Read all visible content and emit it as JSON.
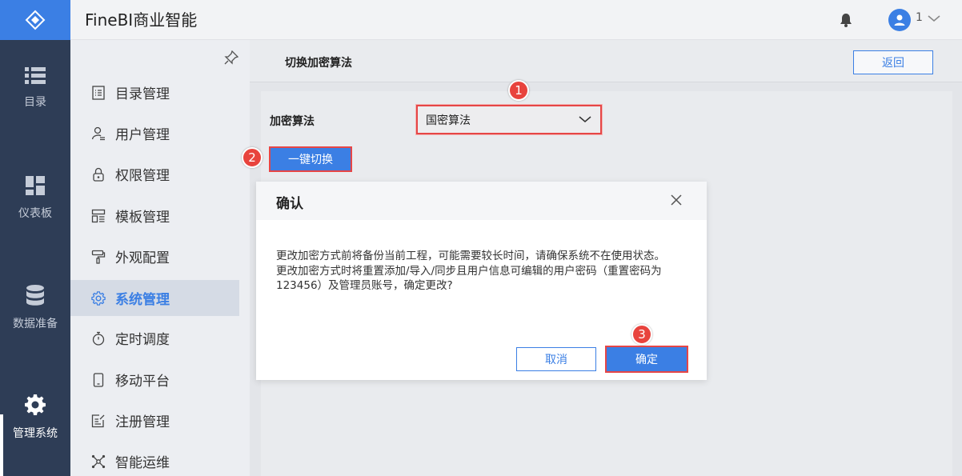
{
  "app": {
    "title": "FineBI商业智能",
    "user_name": "1"
  },
  "rail": {
    "items": [
      {
        "label": "目录"
      },
      {
        "label": "仪表板"
      },
      {
        "label": "数据准备"
      },
      {
        "label": "管理系统"
      }
    ]
  },
  "sidebar": {
    "items": [
      {
        "label": "目录管理"
      },
      {
        "label": "用户管理"
      },
      {
        "label": "权限管理"
      },
      {
        "label": "模板管理"
      },
      {
        "label": "外观配置"
      },
      {
        "label": "系统管理"
      },
      {
        "label": "定时调度"
      },
      {
        "label": "移动平台"
      },
      {
        "label": "注册管理"
      },
      {
        "label": "智能运维"
      }
    ]
  },
  "page": {
    "title": "切换加密算法",
    "back_label": "返回",
    "algo_label": "加密算法",
    "algo_value": "国密算法",
    "switch_label": "一键切换"
  },
  "dialog": {
    "title": "确认",
    "line1": "更改加密方式前将备份当前工程，可能需要较长时间，请确保系统不在使用状态。",
    "line2": "更改加密方式时将重置添加/导入/同步且用户信息可编辑的用户密码（重置密码为123456）及管理员账号，确定更改?",
    "cancel_label": "取消",
    "confirm_label": "确定"
  },
  "badges": {
    "b1": "1",
    "b2": "2",
    "b3": "3"
  },
  "colors": {
    "accent": "#3b7fe4",
    "rail_bg": "#2e3d56",
    "highlight_red": "#e64646"
  }
}
